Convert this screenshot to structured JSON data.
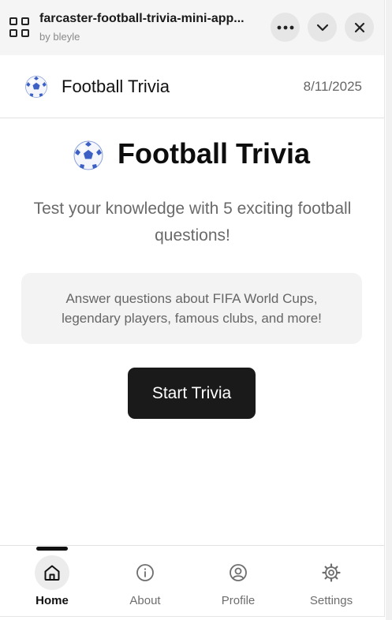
{
  "host": {
    "title": "farcaster-football-trivia-mini-app...",
    "byline": "by bleyle"
  },
  "app_bar": {
    "title": "Football Trivia",
    "date": "8/11/2025"
  },
  "main": {
    "heading": "Football Trivia",
    "subtitle": "Test your knowledge with 5 exciting football questions!",
    "info_text": "Answer questions about FIFA World Cups, legendary players, famous clubs, and more!",
    "start_button": "Start Trivia"
  },
  "nav": {
    "items": [
      {
        "label": "Home",
        "icon": "home-icon",
        "active": true
      },
      {
        "label": "About",
        "icon": "info-icon",
        "active": false
      },
      {
        "label": "Profile",
        "icon": "user-icon",
        "active": false
      },
      {
        "label": "Settings",
        "icon": "gear-icon",
        "active": false
      }
    ]
  },
  "colors": {
    "primary_button": "#1a1a1a",
    "host_header_bg": "#f5f5f5",
    "info_box_bg": "#f3f3f3"
  }
}
